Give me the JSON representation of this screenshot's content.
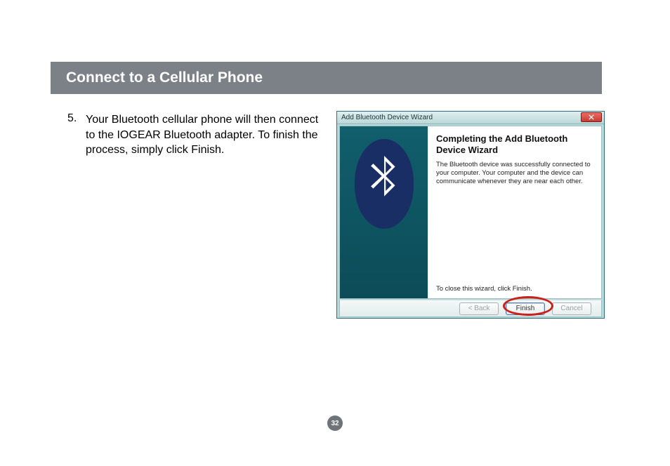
{
  "section": {
    "title": "Connect to a Cellular Phone"
  },
  "step": {
    "number": "5.",
    "text": "Your Bluetooth cellular phone will then connect to the IOGEAR Bluetooth adapter. To finish the process, simply click Finish."
  },
  "dialog": {
    "title": "Add Bluetooth Device Wizard",
    "heading": "Completing the Add Bluetooth Device Wizard",
    "body": "The Bluetooth device was successfully connected to your computer. Your computer and the device can communicate whenever they are near each other.",
    "footnote": "To close this wizard, click Finish.",
    "buttons": {
      "back": "< Back",
      "finish": "Finish",
      "cancel": "Cancel"
    }
  },
  "pageNumber": "32"
}
